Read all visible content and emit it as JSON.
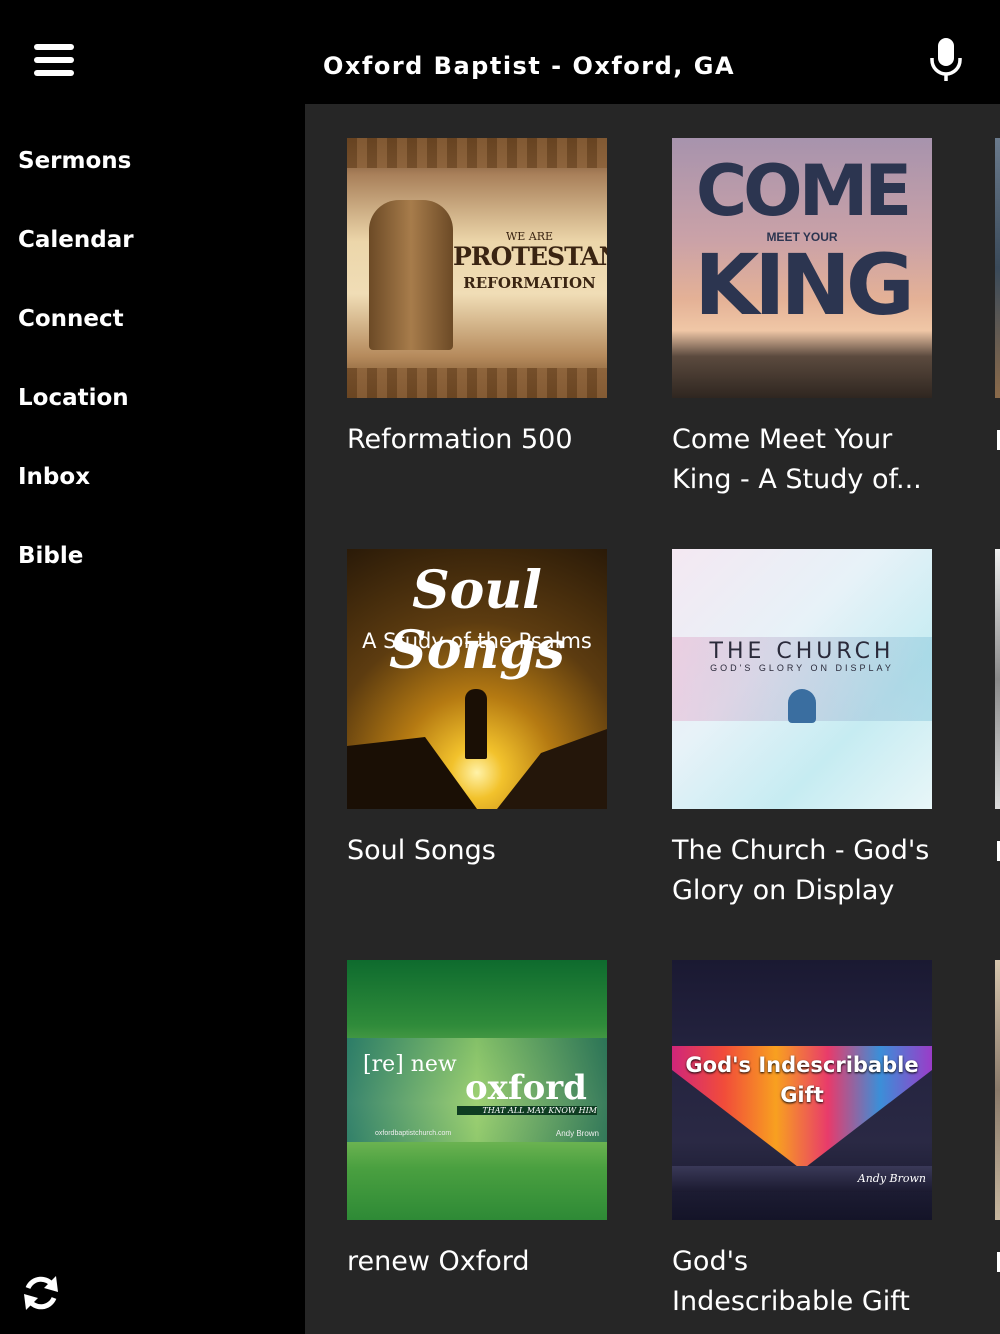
{
  "header": {
    "title": "Oxford Baptist - Oxford, GA",
    "menu_icon": "hamburger-menu-icon",
    "mic_icon": "microphone-icon"
  },
  "sidebar": {
    "items": [
      {
        "label": "Sermons"
      },
      {
        "label": "Calendar"
      },
      {
        "label": "Connect"
      },
      {
        "label": "Location"
      },
      {
        "label": "Inbox"
      },
      {
        "label": "Bible"
      }
    ],
    "refresh_icon": "refresh-icon"
  },
  "series": [
    {
      "title": "Reformation 500",
      "art": {
        "line1": "WE ARE",
        "line2": "PROTESTANT",
        "line3": "REFORMATION"
      }
    },
    {
      "title": "Come Meet Your King - A Study of...",
      "art": {
        "line1": "COME",
        "line2": "MEET YOUR",
        "line3": "KING"
      }
    },
    {
      "title": "Soul Songs",
      "art": {
        "line1": "Soul Songs",
        "line2": "A Study of the Psalms"
      }
    },
    {
      "title": "The Church - God's Glory on Display",
      "art": {
        "line1": "THE CHURCH",
        "line2": "GOD'S GLORY ON DISPLAY"
      }
    },
    {
      "title": "renew Oxford",
      "art": {
        "line1": "[re] new",
        "line2": "oxford",
        "line3": "THAT ALL MAY KNOW HIM",
        "line4": "oxfordbaptistchurch.com",
        "line5": "Andy Brown"
      }
    },
    {
      "title": "God's Indescribable Gift",
      "art": {
        "line1": "God's Indescribable Gift",
        "line2": "Andy Brown"
      }
    }
  ],
  "colors": {
    "background": "#000000",
    "content_background": "#262626",
    "text": "#ffffff"
  }
}
